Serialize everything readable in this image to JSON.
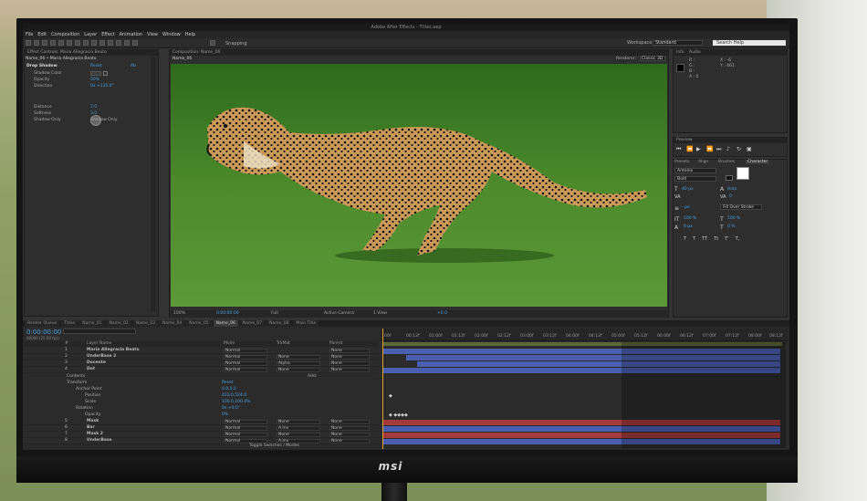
{
  "app": {
    "title": "Adobe After Effects - Titles.aep"
  },
  "menu": [
    "File",
    "Edit",
    "Composition",
    "Layer",
    "Effect",
    "Animation",
    "View",
    "Window",
    "Help"
  ],
  "toolbar": {
    "snapping_label": "Snapping",
    "workspace_label": "Workspace:",
    "workspace_value": "Standard",
    "search_placeholder": "Search Help"
  },
  "effect_controls": {
    "tab": "Effect Controls: Maria Allegracia Beato",
    "subtitle": "Name_06 • Maria Allegracia Beato",
    "effect_name": "Drop Shadow",
    "reset_label": "Reset",
    "about_label": "Ab",
    "props": [
      {
        "label": "Shadow Color",
        "value": ""
      },
      {
        "label": "Opacity",
        "value": "50%"
      },
      {
        "label": "Direction",
        "value": "0x +135.0°"
      },
      {
        "label": "Distance",
        "value": "7.0"
      },
      {
        "label": "Softness",
        "value": "3.0"
      },
      {
        "label": "Shadow Only",
        "value": "Shadow Only"
      }
    ]
  },
  "composition": {
    "tab": "Composition: Name_06",
    "subtab": "Name_06",
    "renderer_label": "Renderer:",
    "renderer_value": "Classic 3D",
    "zoom": "100%",
    "timecode": "0:00:00:00",
    "resolution": "Full",
    "camera": "Active Camera",
    "view": "1 View",
    "exposure": "+0.0"
  },
  "info": {
    "tabs": [
      "Info",
      "Audio"
    ],
    "channels": [
      "R :",
      "G :",
      "B :",
      "A : 0"
    ],
    "coords": [
      "X : -6",
      "Y : 461"
    ]
  },
  "preview": {
    "tab": "Preview"
  },
  "character": {
    "tabs": [
      "Presets",
      "Align",
      "Brushes",
      "Character"
    ],
    "font": "Antonio",
    "style": "Bold",
    "font_size": "40 px",
    "leading": "Auto",
    "tracking": "0",
    "stroke": "- px",
    "stroke_type": "Fill Over Stroke",
    "vscale": "100 %",
    "hscale": "100 %",
    "baseline": "0 px",
    "tsume": "0 %",
    "styles": [
      "T",
      "T",
      "TT",
      "Tt",
      "T'",
      "T,"
    ]
  },
  "timeline": {
    "tabs": [
      "Render Queue",
      "Titles",
      "Name_01",
      "Name_02",
      "Name_03",
      "Name_04",
      "Name_05",
      "Name_06",
      "Name_07",
      "Name_08",
      "Main Title"
    ],
    "active_tab": "Name_06",
    "timecode": "0:00:00:00",
    "fps": "00000 (25.00 fps)",
    "columns": {
      "num": "#",
      "name": "Layer Name",
      "mode": "Mode",
      "trkmat": "TrkMat",
      "parent": "Parent"
    },
    "ticks": [
      "00f",
      "00:12f",
      "01:00f",
      "01:12f",
      "02:00f",
      "02:12f",
      "03:00f",
      "03:12f",
      "04:00f",
      "04:12f",
      "05:00f",
      "05:12f",
      "06:00f",
      "06:12f",
      "07:00f",
      "07:12f",
      "08:00f",
      "08:12f"
    ],
    "layers": [
      {
        "num": "1",
        "name": "Maria Allegracia Beato",
        "mode": "Normal",
        "trkmat": "",
        "parent": "None"
      },
      {
        "num": "2",
        "name": "UnderBase 2",
        "mode": "Normal",
        "trkmat": "None",
        "parent": "None"
      },
      {
        "num": "3",
        "name": "Docente",
        "mode": "Normal",
        "trkmat": "Alpha",
        "parent": "None"
      },
      {
        "num": "4",
        "name": "Dot",
        "mode": "Normal",
        "trkmat": "None",
        "parent": "None"
      }
    ],
    "properties": [
      {
        "label": "Contents",
        "value": "Add:"
      },
      {
        "label": "Transform",
        "value": "Reset"
      },
      {
        "label": "Anchor Point",
        "value": "0.0,0.0"
      },
      {
        "label": "Position",
        "value": "433.0,524.0"
      },
      {
        "label": "Scale",
        "value": "100.0,100.0%"
      },
      {
        "label": "Rotation",
        "value": "0x +0.0°"
      },
      {
        "label": "Opacity",
        "value": "0%"
      }
    ],
    "layers2": [
      {
        "num": "5",
        "name": "Mask",
        "mode": "Normal",
        "trkmat": "None",
        "parent": "None"
      },
      {
        "num": "6",
        "name": "Bar",
        "mode": "Normal",
        "trkmat": "A.Inv",
        "parent": "None"
      },
      {
        "num": "7",
        "name": "Mask 2",
        "mode": "Normal",
        "trkmat": "None",
        "parent": "None"
      },
      {
        "num": "8",
        "name": "UnderBase",
        "mode": "Normal",
        "trkmat": "A.Inv",
        "parent": "None"
      }
    ],
    "toggle_label": "Toggle Switches / Modes"
  },
  "monitor": {
    "brand": "msi"
  },
  "colors": {
    "accent": "#4aa0e0",
    "cti": "#e4a230",
    "bar_blue": "#4b5fb0",
    "bar_red": "#a43a3a"
  }
}
